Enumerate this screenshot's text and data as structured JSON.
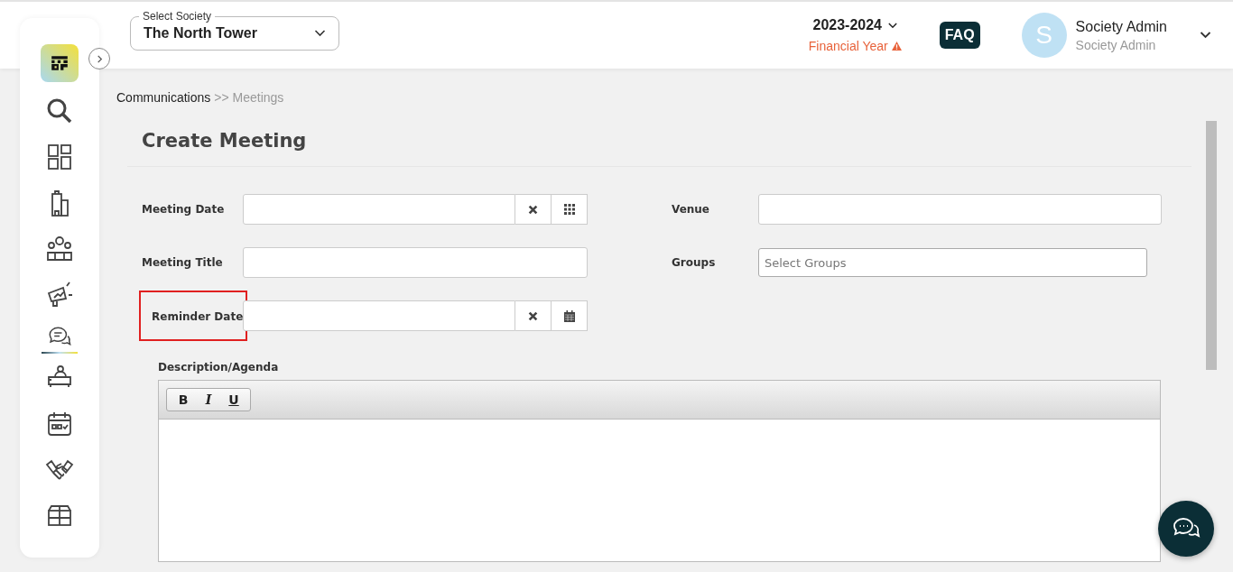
{
  "header": {
    "society_select": {
      "label": "Select Society",
      "value": "The North Tower"
    },
    "financial_year": {
      "value": "2023-2024",
      "label": "Financial Year",
      "warning": true
    },
    "faq": "FAQ",
    "user": {
      "initial": "S",
      "name": "Society Admin",
      "role": "Society Admin"
    }
  },
  "sidebar": {
    "items": [
      {
        "kind": "search",
        "selected": false
      },
      {
        "kind": "dashboard",
        "selected": false
      },
      {
        "kind": "building",
        "selected": false
      },
      {
        "kind": "people",
        "selected": false
      },
      {
        "kind": "megaphone",
        "selected": false
      },
      {
        "kind": "chat",
        "selected": true
      },
      {
        "kind": "desk",
        "selected": false
      },
      {
        "kind": "calendar",
        "selected": false
      },
      {
        "kind": "handshake",
        "selected": false
      },
      {
        "kind": "box",
        "selected": false
      }
    ]
  },
  "breadcrumb": [
    {
      "label": "Communications",
      "current": false
    },
    {
      "label": ">> Meetings",
      "current": true
    }
  ],
  "form": {
    "title": "Create Meeting",
    "left_fields": [
      {
        "label": "Meeting Date",
        "kind": "date",
        "buttons": [
          {
            "kind": "clear"
          },
          {
            "kind": "grid"
          }
        ],
        "highlighted": false
      },
      {
        "label": "Meeting Title",
        "kind": "text",
        "highlighted": false
      },
      {
        "label": "Reminder Date",
        "kind": "date",
        "buttons": [
          {
            "kind": "clear"
          },
          {
            "kind": "calendar"
          }
        ],
        "highlighted": true
      }
    ],
    "right_fields": [
      {
        "label": "Venue",
        "kind": "text"
      },
      {
        "label": "Groups",
        "kind": "select",
        "placeholder": "Select Groups"
      }
    ],
    "description": {
      "label": "Description/Agenda",
      "toolbar": [
        "B",
        "I",
        "U"
      ]
    }
  }
}
